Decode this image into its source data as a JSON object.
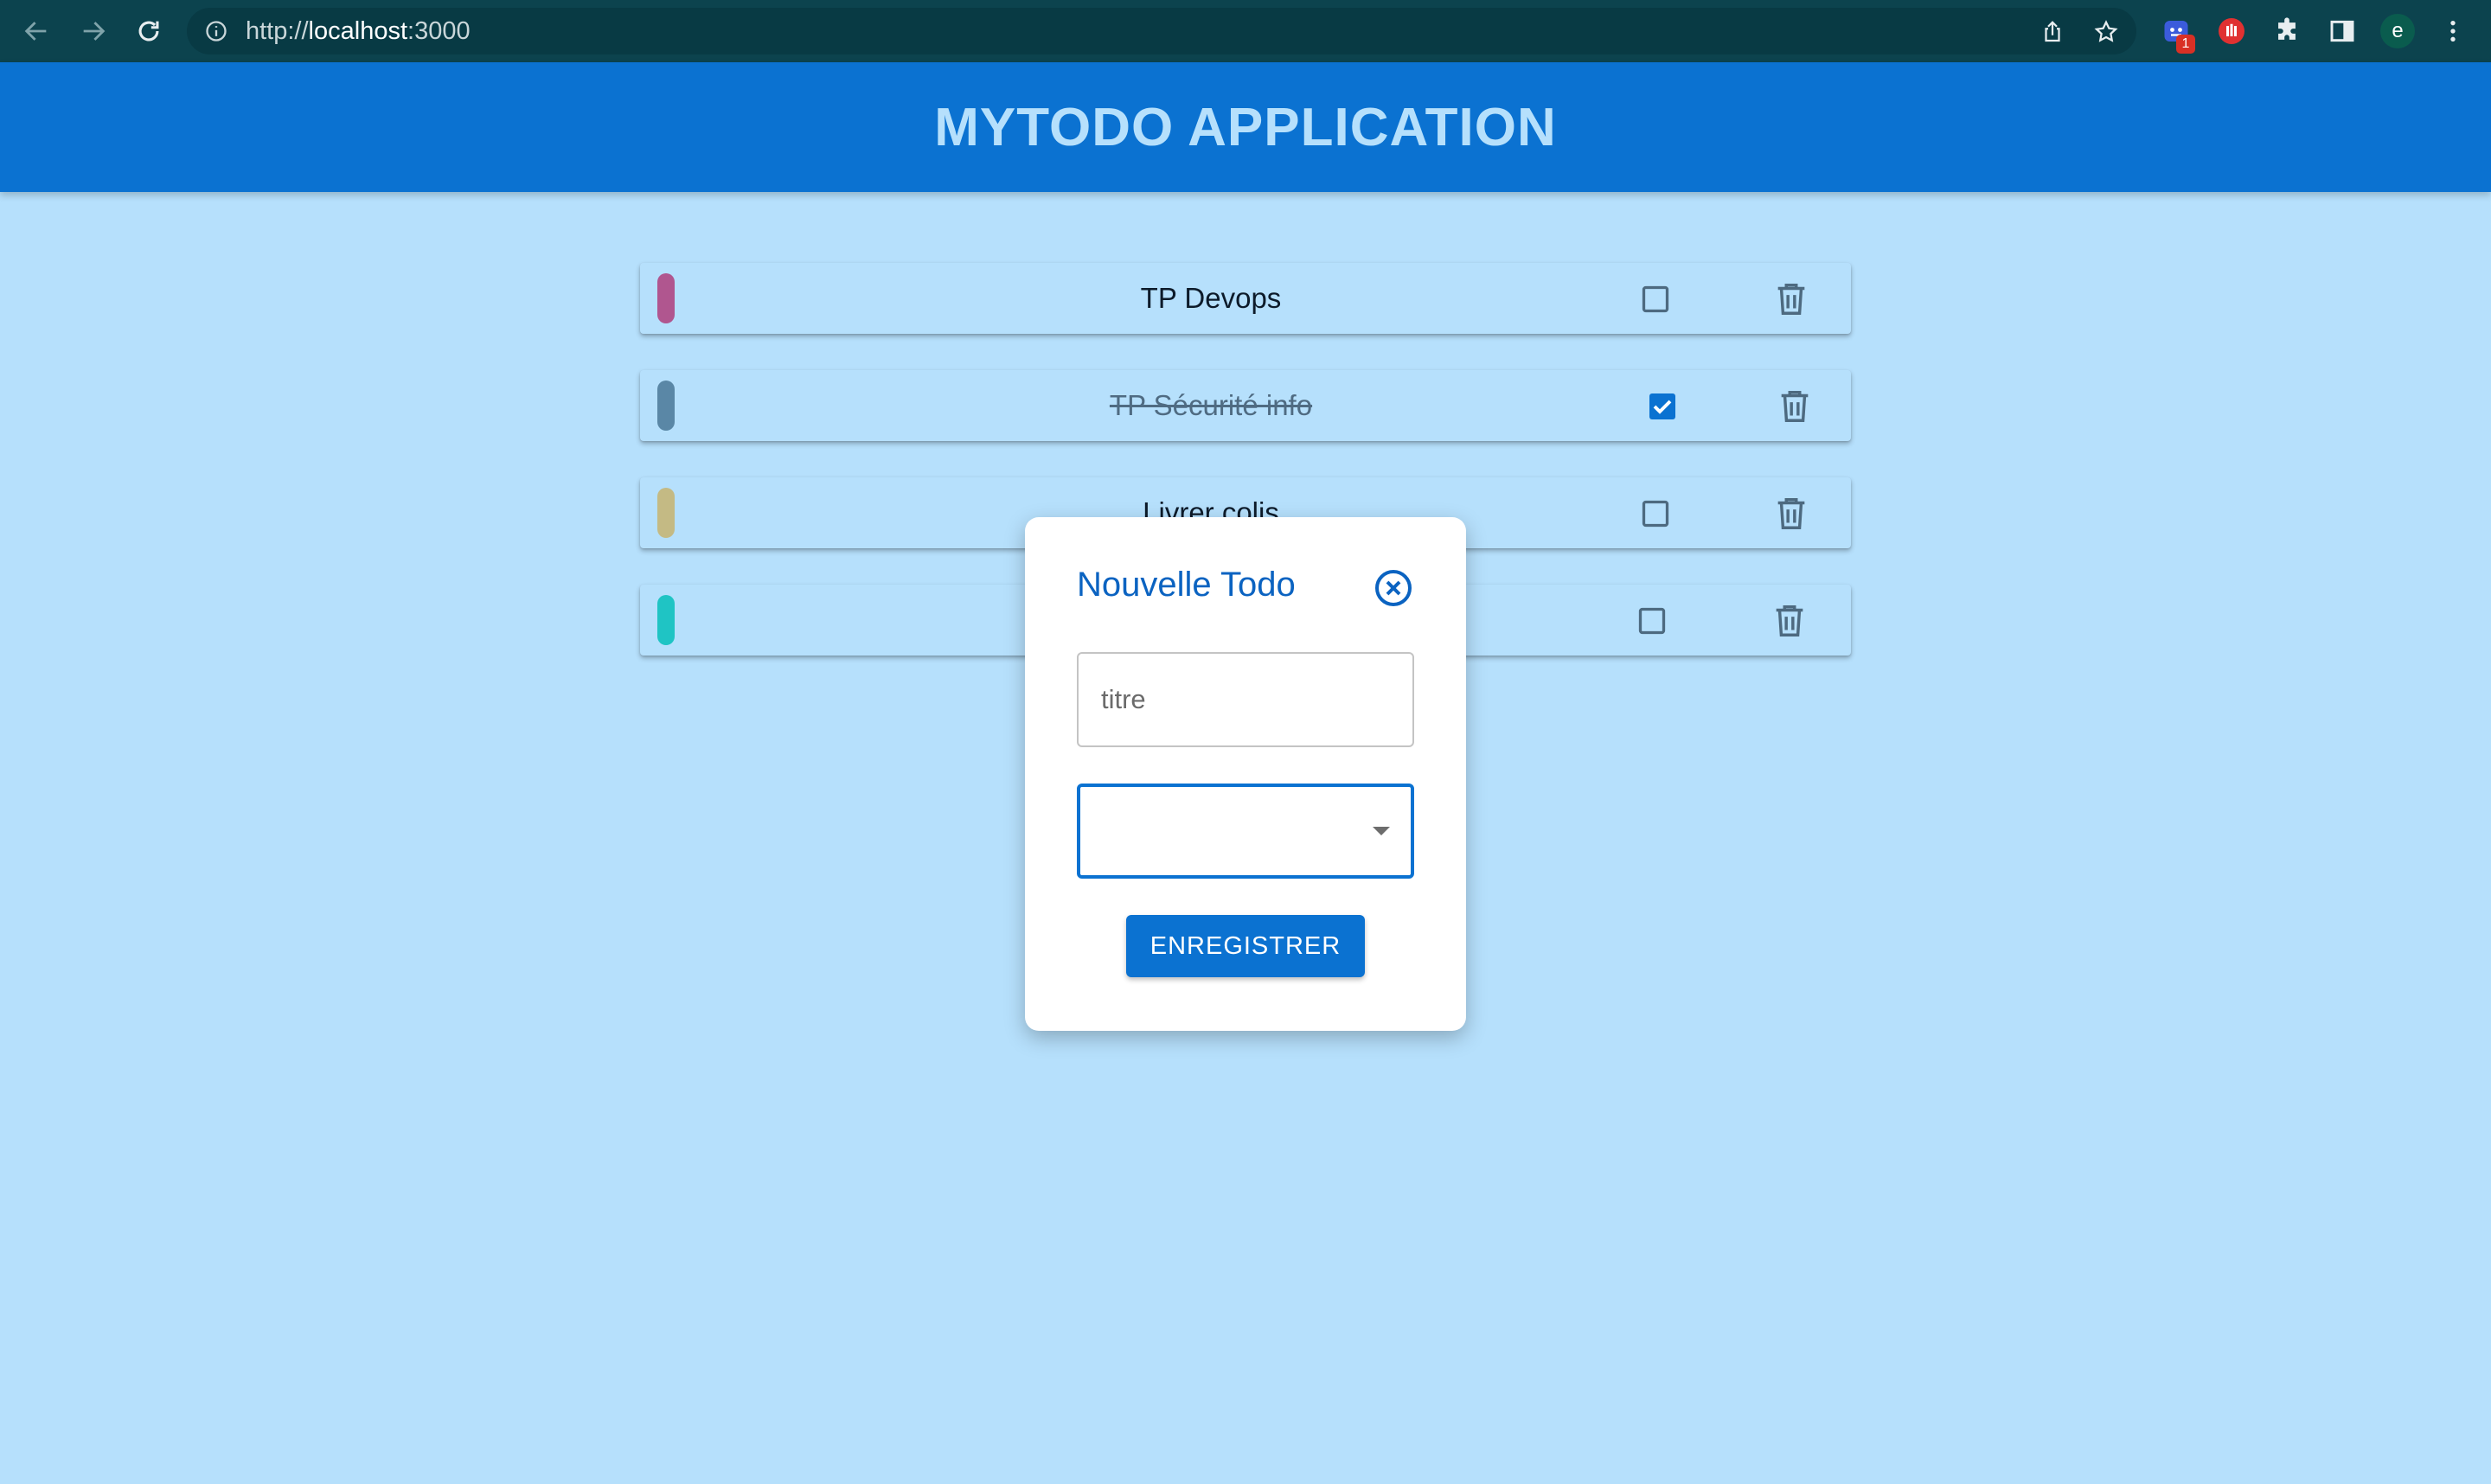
{
  "browser": {
    "url_scheme": "http://",
    "url_host": "localhost",
    "url_port": ":3000",
    "extension_badge": "1",
    "profile_initial": "e",
    "icons": [
      "back-icon",
      "forward-icon",
      "reload-icon",
      "info-icon",
      "share-icon",
      "star-icon",
      "extension-icon",
      "block-icon",
      "puzzle-icon",
      "sidepanel-icon",
      "menu-icon"
    ]
  },
  "header": {
    "title": "MYTODO APPLICATION"
  },
  "todos": [
    {
      "title": "TP Devops",
      "color": "#b0568f",
      "done": false
    },
    {
      "title": "TP Sécurité info",
      "color": "#5a87a6",
      "done": true
    },
    {
      "title": "Livrer colis",
      "color": "#c4ba84",
      "done": false
    },
    {
      "title": "",
      "color": "#1fc4c4",
      "done": false
    }
  ],
  "modal": {
    "title": "Nouvelle Todo",
    "title_placeholder": "titre",
    "select_value": "",
    "save_label": "ENREGISTRER"
  },
  "colors": {
    "header_bg": "#0b72d1",
    "page_bg": "#b6e0fc",
    "accent": "#0b72d1"
  }
}
